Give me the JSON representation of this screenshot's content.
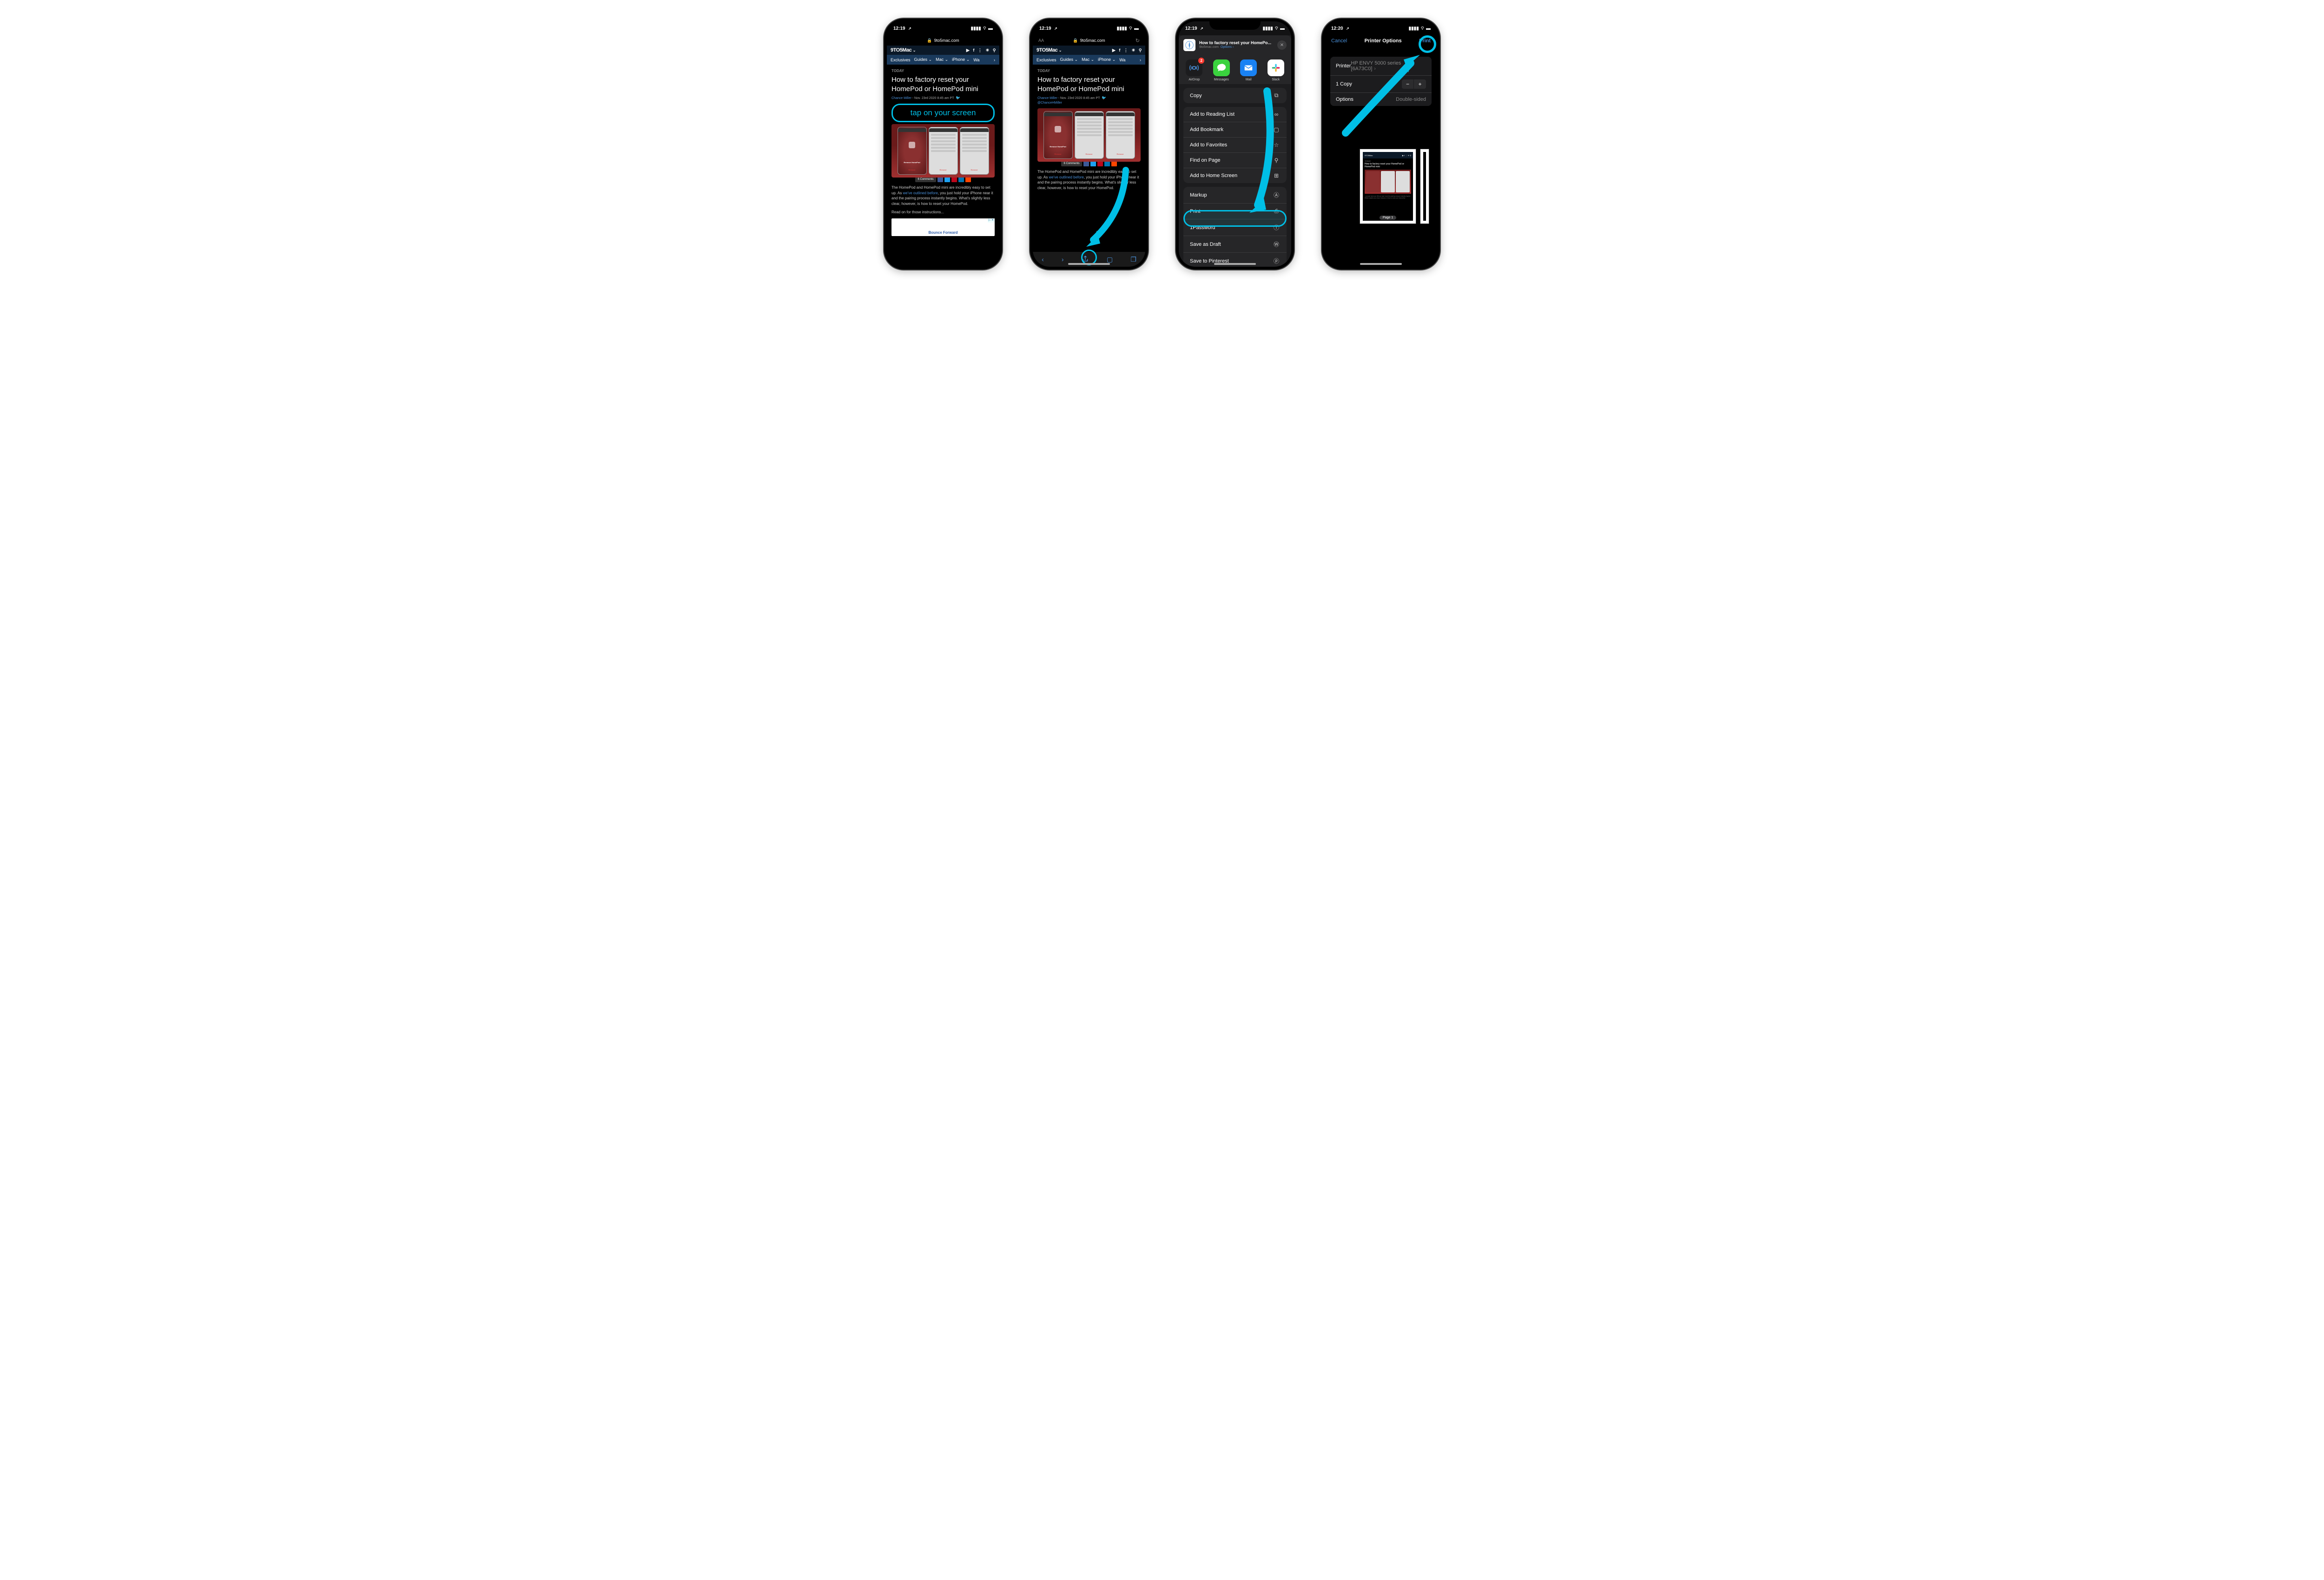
{
  "status": {
    "time_a": "12:19",
    "time_b": "12:20",
    "loc_arrow": "↗"
  },
  "url_host": "9to5mac.com",
  "site_brand": "9TO5Mac",
  "nav_items": [
    "Exclusives",
    "Guides",
    "Mac",
    "iPhone",
    "Wa"
  ],
  "today_label": "TODAY",
  "headline": "How to factory reset your HomePod or HomePod mini",
  "byline_author": "Chance Miller",
  "byline_date": "- Nov. 23rd 2020 8:45 am PT",
  "byline_handle": "@ChanceHMiller",
  "comments_label": "6 Comments",
  "mock_label_home": "Remove HomePod",
  "mock_label_remove": "Remove",
  "article_p1a": "The HomePod and HomePod mini are incredibly easy to set up. As ",
  "article_p1_link": "we've outlined before",
  "article_p1b": ", you just hold your iPhone near it and the pairing process instantly begins. What's slightly less clear, however, is how to reset your HomePod.",
  "article_p2": "Read on for those instructions...",
  "ad_label": "▷ ✕",
  "ad_text": "Bounce Forward",
  "callout_tap": "tap on your screen",
  "aa_label": "AA",
  "share_header": {
    "title": "How to factory reset your HomePo...",
    "sub_host": "9to5mac.com",
    "options": "Options",
    "disclosure": "›"
  },
  "share_apps": [
    {
      "id": "airdrop",
      "label": "AirDrop",
      "badge": "2"
    },
    {
      "id": "messages",
      "label": "Messages"
    },
    {
      "id": "mail",
      "label": "Mail"
    },
    {
      "id": "slack",
      "label": "Slack"
    }
  ],
  "share_rows_g1": [
    {
      "id": "copy",
      "label": "Copy",
      "icon": "⧉"
    }
  ],
  "share_rows_g2": [
    {
      "id": "reading-list",
      "label": "Add to Reading List",
      "icon": "∞"
    },
    {
      "id": "bookmark",
      "label": "Add Bookmark",
      "icon": "▢"
    },
    {
      "id": "favorites",
      "label": "Add to Favorites",
      "icon": "☆"
    },
    {
      "id": "find",
      "label": "Find on Page",
      "icon": "⚲"
    },
    {
      "id": "home-screen",
      "label": "Add to Home Screen",
      "icon": "⊞"
    }
  ],
  "share_rows_g3": [
    {
      "id": "markup",
      "label": "Markup",
      "icon": "Ⓐ"
    },
    {
      "id": "print",
      "label": "Print",
      "icon": "⎙"
    },
    {
      "id": "1password",
      "label": "1Password",
      "icon": "ⓘ"
    },
    {
      "id": "draft",
      "label": "Save as Draft",
      "icon": "Ⓦ"
    },
    {
      "id": "pinterest",
      "label": "Save to Pinterest",
      "icon": "ⓟ"
    }
  ],
  "printer": {
    "cancel": "Cancel",
    "title": "Printer Options",
    "print": "Print",
    "printer_label": "Printer",
    "printer_value": "HP ENVY 5000 series [6A73C0]",
    "copies_label": "1 Copy",
    "options_label": "Options",
    "options_value": "Double-sided",
    "page_badge": "Page 1"
  }
}
